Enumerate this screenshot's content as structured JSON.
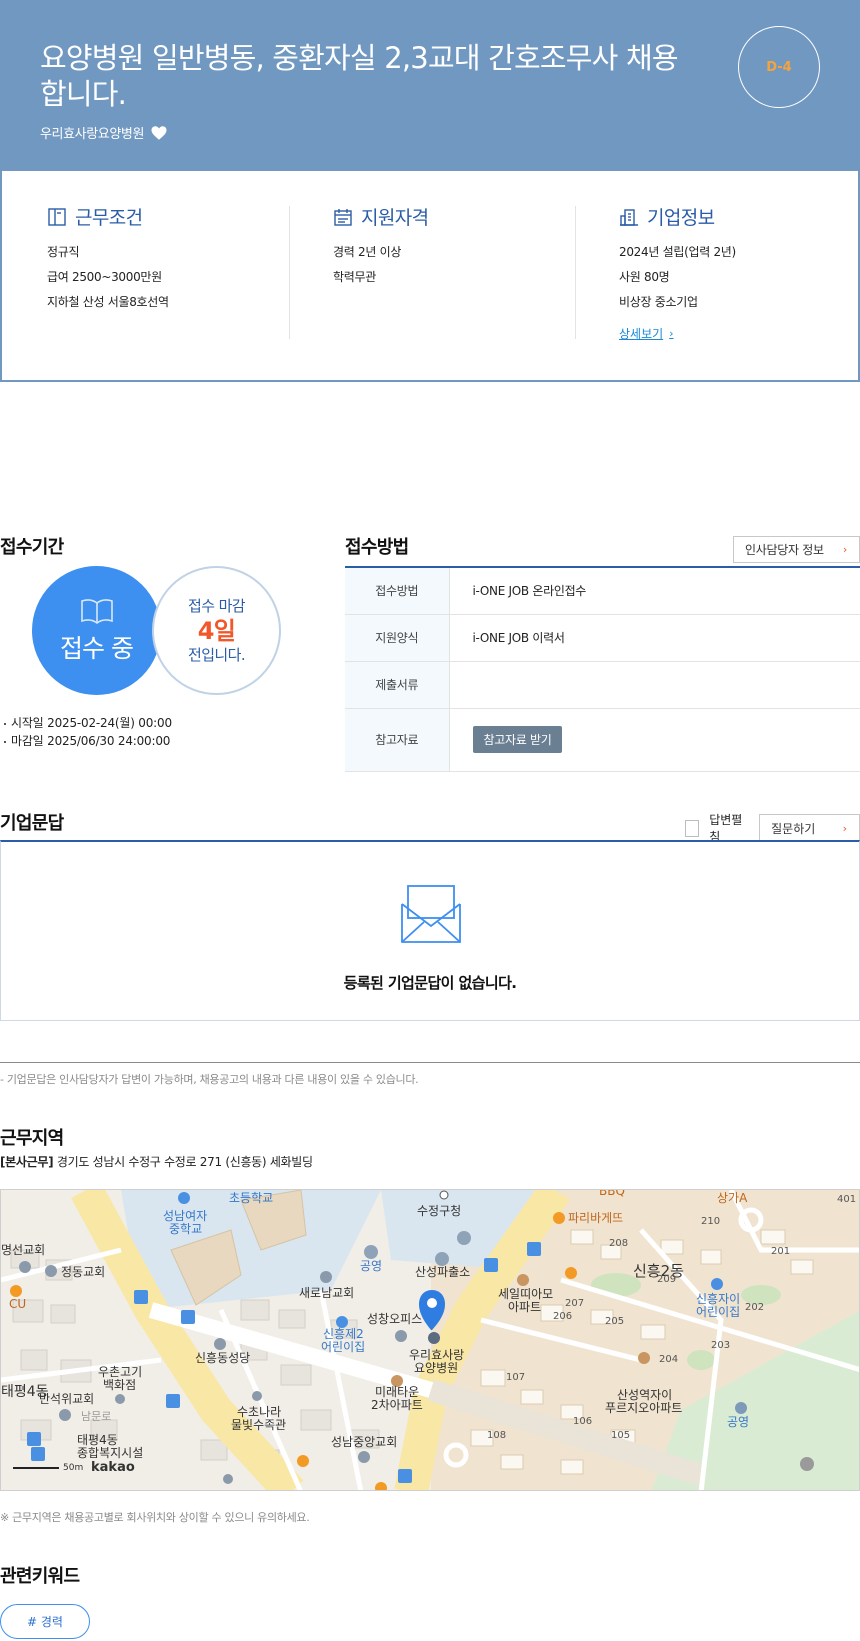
{
  "header": {
    "title": "요양병원 일반병동, 중환자실 2,3교대 간호조무사 채용합니다.",
    "company": "우리효사랑요양병원",
    "dday": "D-4"
  },
  "summary": {
    "work_conditions": {
      "title": "근무조건",
      "lines": [
        "정규직",
        "급여 2500~3000만원",
        "지하철 산성 서울8호선역"
      ]
    },
    "qualifications": {
      "title": "지원자격",
      "lines": [
        "경력 2년 이상",
        "학력무관"
      ]
    },
    "company_info": {
      "title": "기업정보",
      "lines": [
        "2024년 설립(업력 2년)",
        "사원 80명",
        "비상장 중소기업"
      ],
      "more_label": "상세보기"
    }
  },
  "reception_period": {
    "title": "접수기간",
    "status": "접수 중",
    "deadline_prefix": "접수 마감",
    "days_left": "4일",
    "deadline_suffix": "전입니다.",
    "start": "시작일 2025-02-24(월) 00:00",
    "end": "마감일 2025/06/30 24:00:00"
  },
  "reception_method": {
    "title": "접수방법",
    "hr_button": "인사담당자 정보",
    "rows": [
      {
        "key": "접수방법",
        "value": "i-ONE JOB 온라인접수"
      },
      {
        "key": "지원양식",
        "value": "i-ONE JOB 이력서"
      },
      {
        "key": "제출서류",
        "value": ""
      },
      {
        "key": "참고자료",
        "button": "참고자료 받기"
      }
    ]
  },
  "qa": {
    "title": "기업문답",
    "expand_label": "답변펼침",
    "ask_button": "질문하기",
    "empty_message": "등록된 기업문답이 없습니다.",
    "note": "- 기업문답은 인사담당자가 답변이 가능하며, 채용공고의 내용과 다른 내용이 있을 수 있습니다."
  },
  "location": {
    "title": "근무지역",
    "tag": "[본사근무]",
    "address": "경기도 성남시 수정구 수정로 271 (신흥동) 세화빌딩",
    "note": "※ 근무지역은 채용공고별로 회사위치와 상이할 수 있으니 유의하세요.",
    "map_labels": {
      "sujeong_office": "수정구청",
      "paris": "파리바게뜨",
      "bbq": "BBQ",
      "sanga": "상가A",
      "school_girls_1": "성남여자",
      "school_girls_2": "중학교",
      "elem": "초등학교",
      "church_myeongseon": "명선교회",
      "church_jeongdong": "정동교회",
      "police": "산성파출소",
      "parking": "공영",
      "church_saero": "새로남교회",
      "sincheung2": "신흥2동",
      "seil_1": "세일띠아모",
      "seil_2": "아파트",
      "office": "성창오피스",
      "kinder_1": "신흥제2",
      "kinder_2": "어린이집",
      "kinder_b1": "신흥자이",
      "kinder_b2": "어린이집",
      "hospital_1": "우리효사랑",
      "hospital_2": "요양병원",
      "church_sinheung": "신흥동성당",
      "mirae_1": "미래타운",
      "mirae_2": "2차아파트",
      "uchon_1": "우촌고기",
      "uchon_2": "백화점",
      "church_banseok": "반석위교회",
      "suchonara_1": "수초나라",
      "suchonara_2": "물빛수족관",
      "church_jungang": "성남중앙교회",
      "sanseong_1": "산성역자이",
      "sanseong_2": "푸르지오아파트",
      "parking2": "공영",
      "cu": "CU",
      "dong_taepyeong": "태평4동",
      "welfare_1": "태평4동",
      "welfare_2": "종합복지시설",
      "scale": "50m",
      "kakao": "kakao",
      "namhan": "남문로",
      "taepyeong_left": "태평4동"
    }
  },
  "keywords": {
    "title": "관련키워드",
    "tags": [
      "# 경력"
    ]
  }
}
